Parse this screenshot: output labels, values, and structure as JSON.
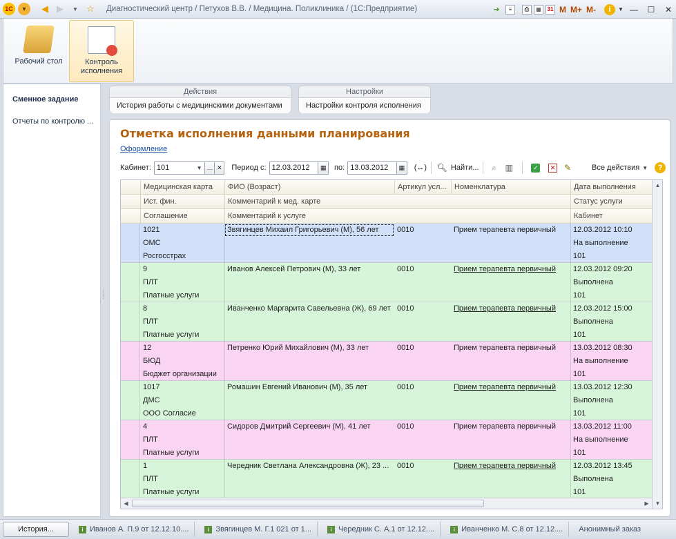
{
  "window": {
    "title": "Диагностический центр / Петухов В.В. /  Медицина. Поликлиника / (1С:Предприятие)",
    "logo": "1С",
    "toolbar_m": [
      "M",
      "M+",
      "M-"
    ]
  },
  "sections": [
    {
      "label": "Рабочий стол"
    },
    {
      "label": "Контроль исполнения"
    }
  ],
  "left_panel": {
    "items": [
      "Сменное задание",
      "Отчеты по контролю ..."
    ]
  },
  "commands": {
    "actions": {
      "head": "Действия",
      "item": "История работы с медицинскими документами"
    },
    "settings": {
      "head": "Настройки",
      "item": "Настройки контроля исполнения"
    }
  },
  "form": {
    "title": "Отметка исполнения данными планирования",
    "link": "Оформление",
    "cabinet_label": "Кабинет:",
    "cabinet_value": "101",
    "period_label": "Период с:",
    "date_from": "12.03.2012",
    "to_label": "по:",
    "date_to": "13.03.2012",
    "period_btn": "(↔)",
    "find_label": "Найти...",
    "all_actions": "Все действия"
  },
  "table": {
    "header_rows": [
      [
        "Медицинская карта",
        "ФИО (Возраст)",
        "Артикул усл...",
        "Номенклатура",
        "Дата выполнения"
      ],
      [
        "Ист. фин.",
        "Комментарий к мед. карте",
        "Статус услуги"
      ],
      [
        "Соглашение",
        "Комментарий к услуге",
        "Кабинет"
      ]
    ],
    "rows": [
      {
        "card": "1021",
        "fin": "ОМС",
        "agreement": "Росгосстрах",
        "name": "Звягинцев Михаил Григорьевич (М), 56 лет",
        "article": "0010",
        "nomenclature": "Прием терапевта первичный",
        "nom_link": false,
        "date": "12.03.2012 10:10",
        "status": "На выполнение",
        "cabinet": "101",
        "color": "#cfe0f8",
        "selected": true
      },
      {
        "card": "9",
        "fin": "ПЛТ",
        "agreement": "Платные услуги",
        "name": "Иванов Алексей Петрович (М), 33 лет",
        "article": "0010",
        "nomenclature": "Прием терапевта первичный",
        "nom_link": true,
        "date": "12.03.2012 09:20",
        "status": "Выполнена",
        "cabinet": "101",
        "color": "#d7f5d9",
        "selected": false
      },
      {
        "card": "8",
        "fin": "ПЛТ",
        "agreement": "Платные услуги",
        "name": "Иванченко Маргарита Савельевна (Ж), 69 лет",
        "article": "0010",
        "nomenclature": "Прием терапевта первичный",
        "nom_link": true,
        "date": "12.03.2012 15:00",
        "status": "Выполнена",
        "cabinet": "101",
        "color": "#d7f5d9",
        "selected": false
      },
      {
        "card": "12",
        "fin": "БЮД",
        "agreement": "Бюджет организации",
        "name": "Петренко Юрий Михайлович (М), 33 лет",
        "article": "0010",
        "nomenclature": "Прием терапевта первичный",
        "nom_link": false,
        "date": "13.03.2012 08:30",
        "status": "На выполнение",
        "cabinet": "101",
        "color": "#f9d4f3",
        "selected": false
      },
      {
        "card": "1017",
        "fin": "ДМС",
        "agreement": "ООО Согласие",
        "name": "Ромашин Евгений Иванович (М), 35 лет",
        "article": "0010",
        "nomenclature": "Прием терапевта первичный",
        "nom_link": true,
        "date": "13.03.2012 12:30",
        "status": "Выполнена",
        "cabinet": "101",
        "color": "#d7f5d9",
        "selected": false
      },
      {
        "card": "4",
        "fin": "ПЛТ",
        "agreement": "Платные услуги",
        "name": "Сидоров Дмитрий Сергеевич (М), 41 лет",
        "article": "0010",
        "nomenclature": "Прием терапевта первичный",
        "nom_link": false,
        "date": "13.03.2012 11:00",
        "status": "На выполнение",
        "cabinet": "101",
        "color": "#f9d4f3",
        "selected": false
      },
      {
        "card": "1",
        "fin": "ПЛТ",
        "agreement": "Платные услуги",
        "name": "Чередник Светлана Александровна (Ж), 23 ...",
        "article": "0010",
        "nomenclature": "Прием терапевта первичный",
        "nom_link": true,
        "date": "12.03.2012 13:45",
        "status": "Выполнена",
        "cabinet": "101",
        "color": "#d7f5d9",
        "selected": false
      }
    ]
  },
  "bottom": {
    "history": "История...",
    "tasks": [
      "Иванов А. П.9 от 12.12.10....",
      "Звягинцев М. Г.1 021 от 1...",
      "Чередник С. А.1 от 12.12....",
      "Иванченко М. С.8 от 12.12....",
      "Анонимный заказ"
    ]
  }
}
